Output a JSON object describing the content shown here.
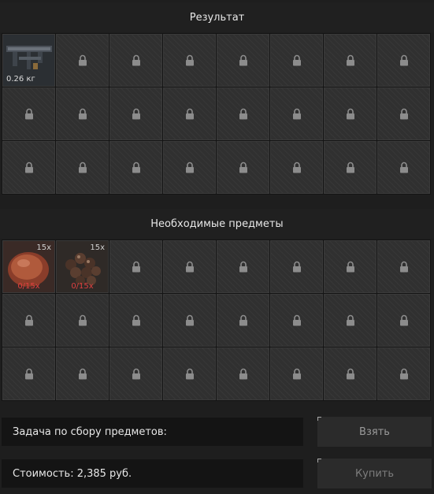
{
  "result": {
    "title": "Результат",
    "items": [
      {
        "name": "rifle-part",
        "weight": "0.26 кг"
      }
    ],
    "rows": 3,
    "cols": 8
  },
  "required": {
    "title": "Необходимые предметы",
    "items": [
      {
        "name": "meat",
        "qty": "15x",
        "need": "0/15x"
      },
      {
        "name": "berries",
        "qty": "15x",
        "need": "0/15x"
      }
    ],
    "rows": 3,
    "cols": 8
  },
  "task": {
    "label": "Задача по сбору предметов:"
  },
  "cost": {
    "label": "Стоимость: 2,385 руб."
  },
  "buttons": {
    "take": "Взять",
    "buy": "Купить"
  },
  "icons": {
    "locked_slot": "lock-icon"
  }
}
